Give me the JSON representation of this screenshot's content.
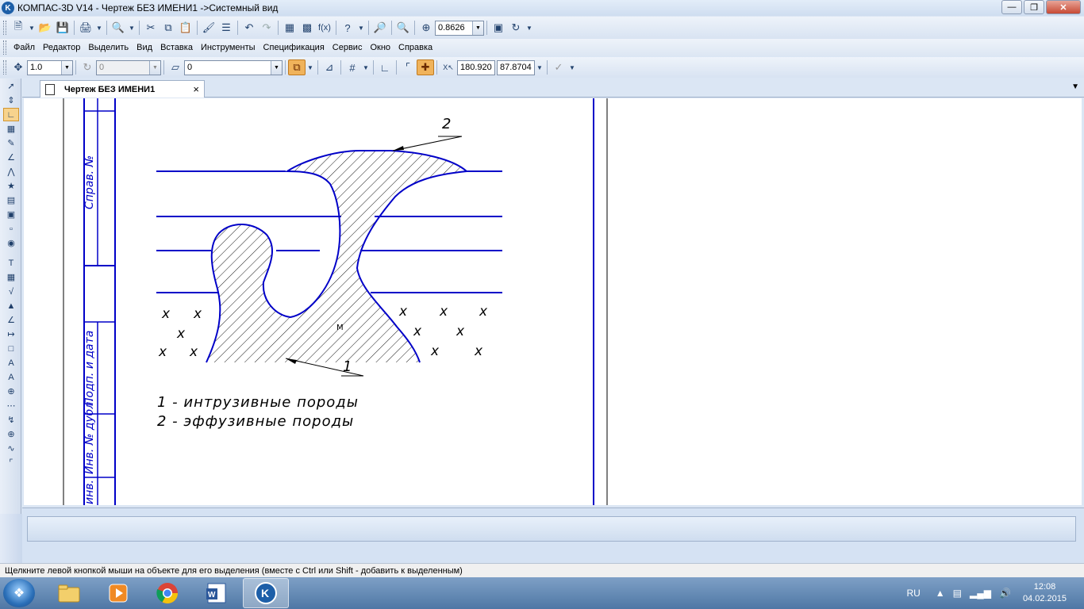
{
  "window": {
    "title": "КОМПАС-3D V14 - Чертеж БЕЗ ИМЕНИ1 ->Системный вид",
    "minimize_icon": "minimize-icon",
    "maximize_icon": "restore-icon",
    "close_icon": "close-icon"
  },
  "standard_toolbar": {
    "zoom_value": "0.8626"
  },
  "menu": {
    "items": [
      "Файл",
      "Редактор",
      "Выделить",
      "Вид",
      "Вставка",
      "Инструменты",
      "Спецификация",
      "Сервис",
      "Окно",
      "Справка"
    ]
  },
  "props_toolbar": {
    "step_value": "1.0",
    "angle_value": "0",
    "layer_value": "0",
    "coord_x": "180.920",
    "coord_y": "87.8704"
  },
  "document_tab": {
    "label": "Чертеж БЕЗ ИМЕНИ1",
    "close": "×"
  },
  "drawing": {
    "label_2": "2",
    "label_1": "1",
    "label_m": "M",
    "legend_1": "1 - интрузивные породы",
    "legend_2": "2 - эффузивные породы",
    "cross": "x",
    "frame_label_sprav": "Справ. №",
    "frame_label_podp": "Подп. и дата",
    "frame_label_inv_dubl": "Инв. № дубл.",
    "frame_label_inv": "инв."
  },
  "status": {
    "text": "Щелкните левой кнопкой мыши на объекте для его выделения (вместе с Ctrl или Shift - добавить к выделенным)"
  },
  "taskbar": {
    "language": "RU",
    "time": "12:08",
    "date": "04.02.2015"
  },
  "colors": {
    "drawing_blue": "#0000c8",
    "hatch": "#000000"
  }
}
